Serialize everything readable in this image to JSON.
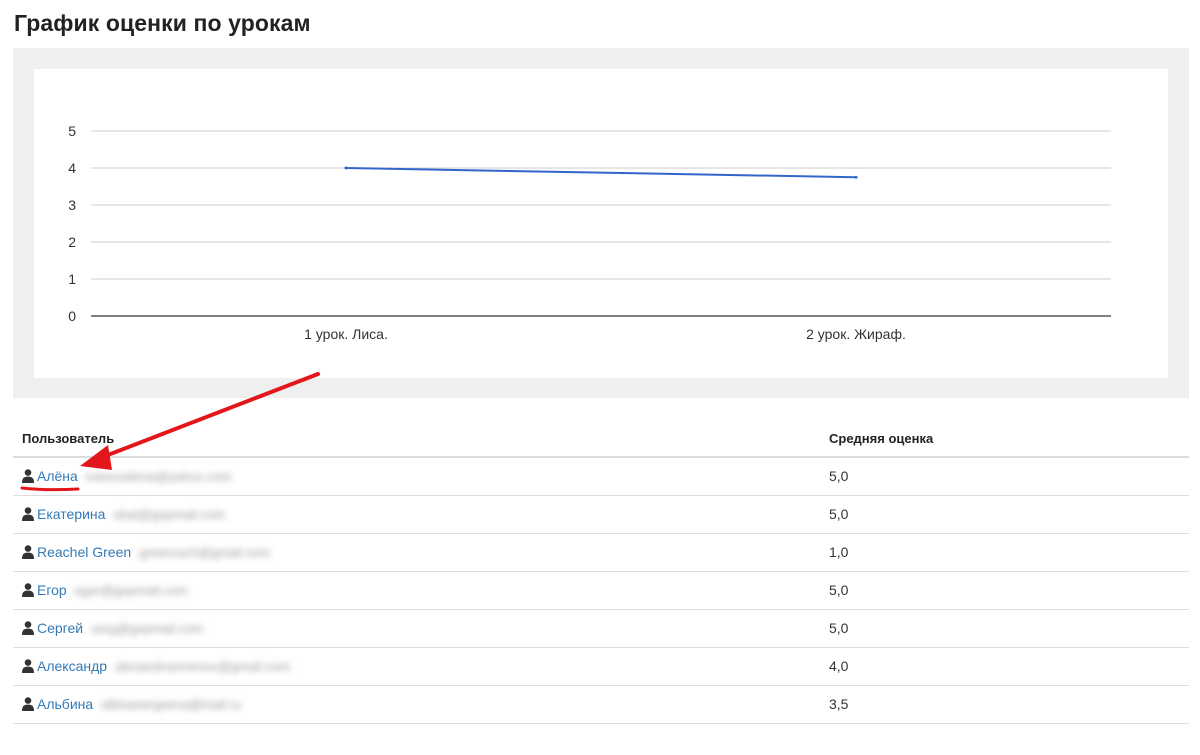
{
  "page": {
    "title": "График оценки по урокам"
  },
  "chart_data": {
    "type": "line",
    "categories": [
      "1 урок. Лиса.",
      "2 урок. Жираф."
    ],
    "series": [
      {
        "values": [
          4.0,
          3.75
        ],
        "color": "#3366cc"
      }
    ],
    "ylim": [
      0,
      5
    ],
    "yticks": [
      "0",
      "1",
      "2",
      "3",
      "4",
      "5"
    ],
    "grid": true,
    "legend": "none"
  },
  "table": {
    "headers": {
      "user": "Пользователь",
      "score": "Средняя оценка"
    },
    "rows": [
      {
        "name": "Алёна",
        "email": "ivanovalena@yahoo.com",
        "score": "5,0"
      },
      {
        "name": "Екатерина",
        "email": "ekat@gopmail.com",
        "score": "5,0"
      },
      {
        "name": "Reachel Green",
        "email": "greenrach@gmail.com",
        "score": "1,0"
      },
      {
        "name": "Егор",
        "email": "egor@gopmail.com",
        "score": "5,0"
      },
      {
        "name": "Сергей",
        "email": "serg@gopmail.com",
        "score": "5,0"
      },
      {
        "name": "Александр",
        "email": "alexandrsemenov@gmail.com",
        "score": "4,0"
      },
      {
        "name": "Альбина",
        "email": "albinasergeeva@mail.ru",
        "score": "3,5"
      }
    ]
  },
  "annotation": {
    "arrow_color": "#e3171b",
    "icon": "red-arrow-icon"
  }
}
